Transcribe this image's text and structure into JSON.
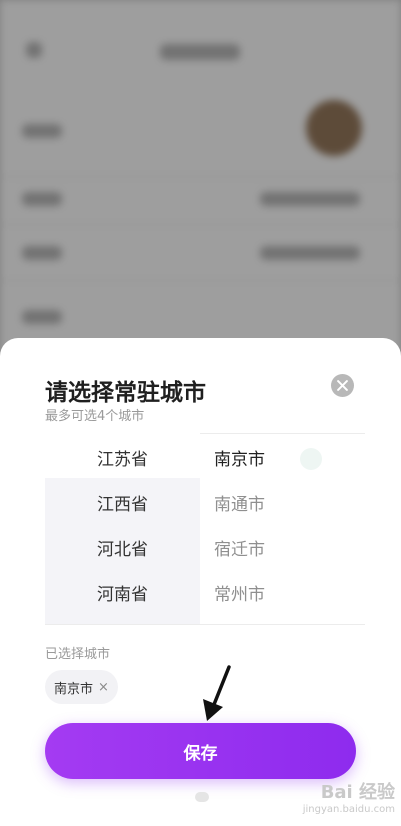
{
  "sheet": {
    "title": "请选择常驻城市",
    "subtitle": "最多可选4个城市"
  },
  "picker": {
    "provinces": [
      "江苏省",
      "江西省",
      "河北省",
      "河南省"
    ],
    "cities": [
      "南京市",
      "南通市",
      "宿迁市",
      "常州市"
    ],
    "selected_province_index": 0,
    "selected_city_index": 0
  },
  "selected": {
    "label": "已选择城市",
    "chips": [
      {
        "name": "南京市",
        "remove": "×"
      }
    ]
  },
  "save_button": {
    "label": "保存"
  },
  "watermark": {
    "line1": "Bai 经验",
    "line2": "jingyan.baidu.com"
  },
  "icons": {
    "close": "close-icon",
    "arrow": "arrow-annotation-icon"
  },
  "colors": {
    "accent": "#9a33f0",
    "sheet": "#ffffff"
  }
}
